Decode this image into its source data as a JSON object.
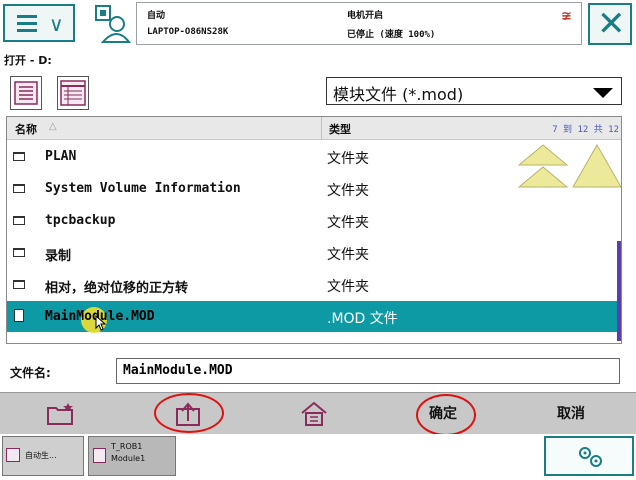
{
  "header": {
    "mode": "自动",
    "host": "LAPTOP-O86NS28K",
    "motor_state": "电机开启",
    "run_state": "已停止 (速度 100%)"
  },
  "path": "打开 - D:",
  "filter": {
    "selected": "模块文件 (*.mod)"
  },
  "list": {
    "col_name": "名称",
    "col_type": "类型",
    "count": "7 到 12 共 12",
    "rows": [
      {
        "name": "PLAN",
        "type": "文件夹",
        "kind": "folder"
      },
      {
        "name": "System Volume Information",
        "type": "文件夹",
        "kind": "folder"
      },
      {
        "name": "tpcbackup",
        "type": "文件夹",
        "kind": "folder"
      },
      {
        "name": "录制",
        "type": "文件夹",
        "kind": "folder"
      },
      {
        "name": "相对，绝对位移的正方转",
        "type": "文件夹",
        "kind": "folder"
      },
      {
        "name": "MainModule.MOD",
        "type": ".MOD 文件",
        "kind": "file",
        "selected": true
      }
    ]
  },
  "filename": {
    "label": "文件名:",
    "value": "MainModule.MOD"
  },
  "toolbar": {
    "ok_label": "确定",
    "cancel_label": "取消"
  },
  "taskbar": {
    "task1_label": "自动生...",
    "task2_line1": "T_ROB1",
    "task2_line2": "Module1"
  },
  "colors": {
    "accent": "#1a7d86",
    "selection": "#0e9aa5",
    "annotation": "#e01010"
  }
}
